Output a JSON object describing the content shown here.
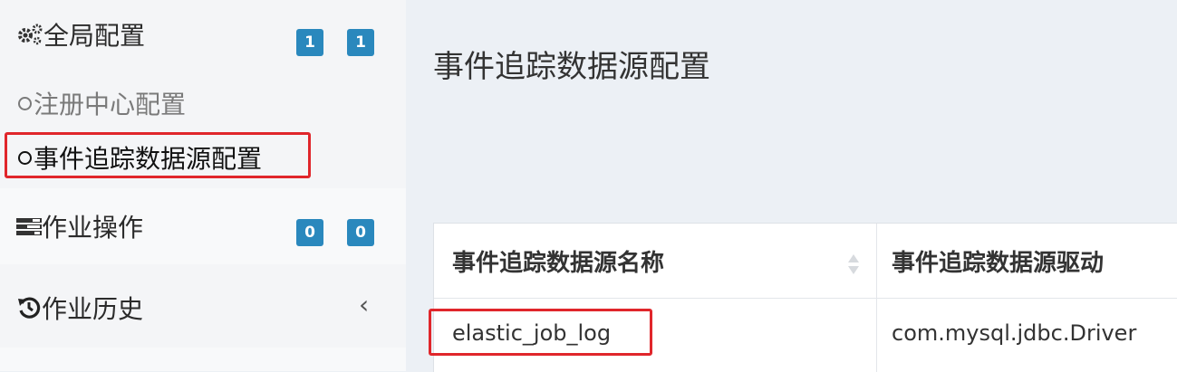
{
  "sidebar": {
    "global_config": {
      "label": "全局配置",
      "icon": "gears-icon",
      "badges": [
        "1",
        "1"
      ],
      "children": [
        {
          "label": "注册中心配置",
          "active": false
        },
        {
          "label": "事件追踪数据源配置",
          "active": true
        }
      ]
    },
    "job_ops": {
      "label": "作业操作",
      "icon": "tasks-icon",
      "badges": [
        "0",
        "0"
      ]
    },
    "job_history": {
      "label": "作业历史",
      "icon": "history-icon",
      "chevron": "‹"
    }
  },
  "main": {
    "title": "事件追踪数据源配置",
    "table": {
      "columns": [
        "事件追踪数据源名称",
        "事件追踪数据源驱动"
      ],
      "rows": [
        [
          "elastic_job_log",
          "com.mysql.jdbc.Driver"
        ]
      ]
    }
  },
  "colors": {
    "badge": "#2a88bd",
    "highlight": "#e0262b",
    "sidebar_bg": "#f4f5f7",
    "content_bg": "#ecf0f5"
  }
}
